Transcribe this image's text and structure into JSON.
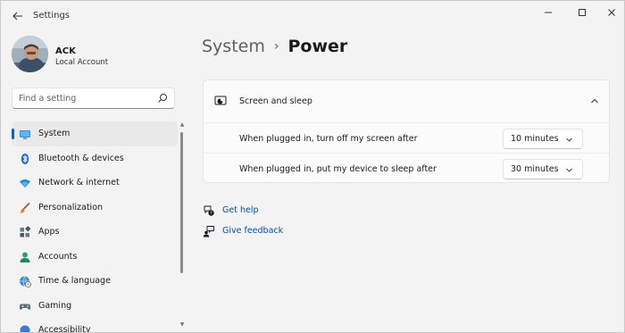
{
  "window": {
    "title": "Settings"
  },
  "profile": {
    "name": "ACK",
    "account_type": "Local Account"
  },
  "search": {
    "placeholder": "Find a setting"
  },
  "nav": {
    "items": [
      {
        "label": "System",
        "icon": "monitor-icon",
        "selected": true
      },
      {
        "label": "Bluetooth & devices",
        "icon": "bluetooth-icon"
      },
      {
        "label": "Network & internet",
        "icon": "wifi-icon"
      },
      {
        "label": "Personalization",
        "icon": "brush-icon"
      },
      {
        "label": "Apps",
        "icon": "apps-icon"
      },
      {
        "label": "Accounts",
        "icon": "person-icon"
      },
      {
        "label": "Time & language",
        "icon": "globe-clock-icon"
      },
      {
        "label": "Gaming",
        "icon": "gamepad-icon"
      },
      {
        "label": "Accessibility",
        "icon": "accessibility-icon"
      }
    ]
  },
  "breadcrumb": {
    "parent": "System",
    "separator": "›",
    "current": "Power"
  },
  "screen_sleep": {
    "title": "Screen and sleep",
    "rows": [
      {
        "label": "When plugged in, turn off my screen after",
        "value": "10 minutes"
      },
      {
        "label": "When plugged in, put my device to sleep after",
        "value": "30 minutes"
      }
    ]
  },
  "links": {
    "get_help": "Get help",
    "give_feedback": "Give feedback"
  },
  "colors": {
    "accent": "#0067c0",
    "link": "#0550a8",
    "background": "#f3f3f3"
  }
}
